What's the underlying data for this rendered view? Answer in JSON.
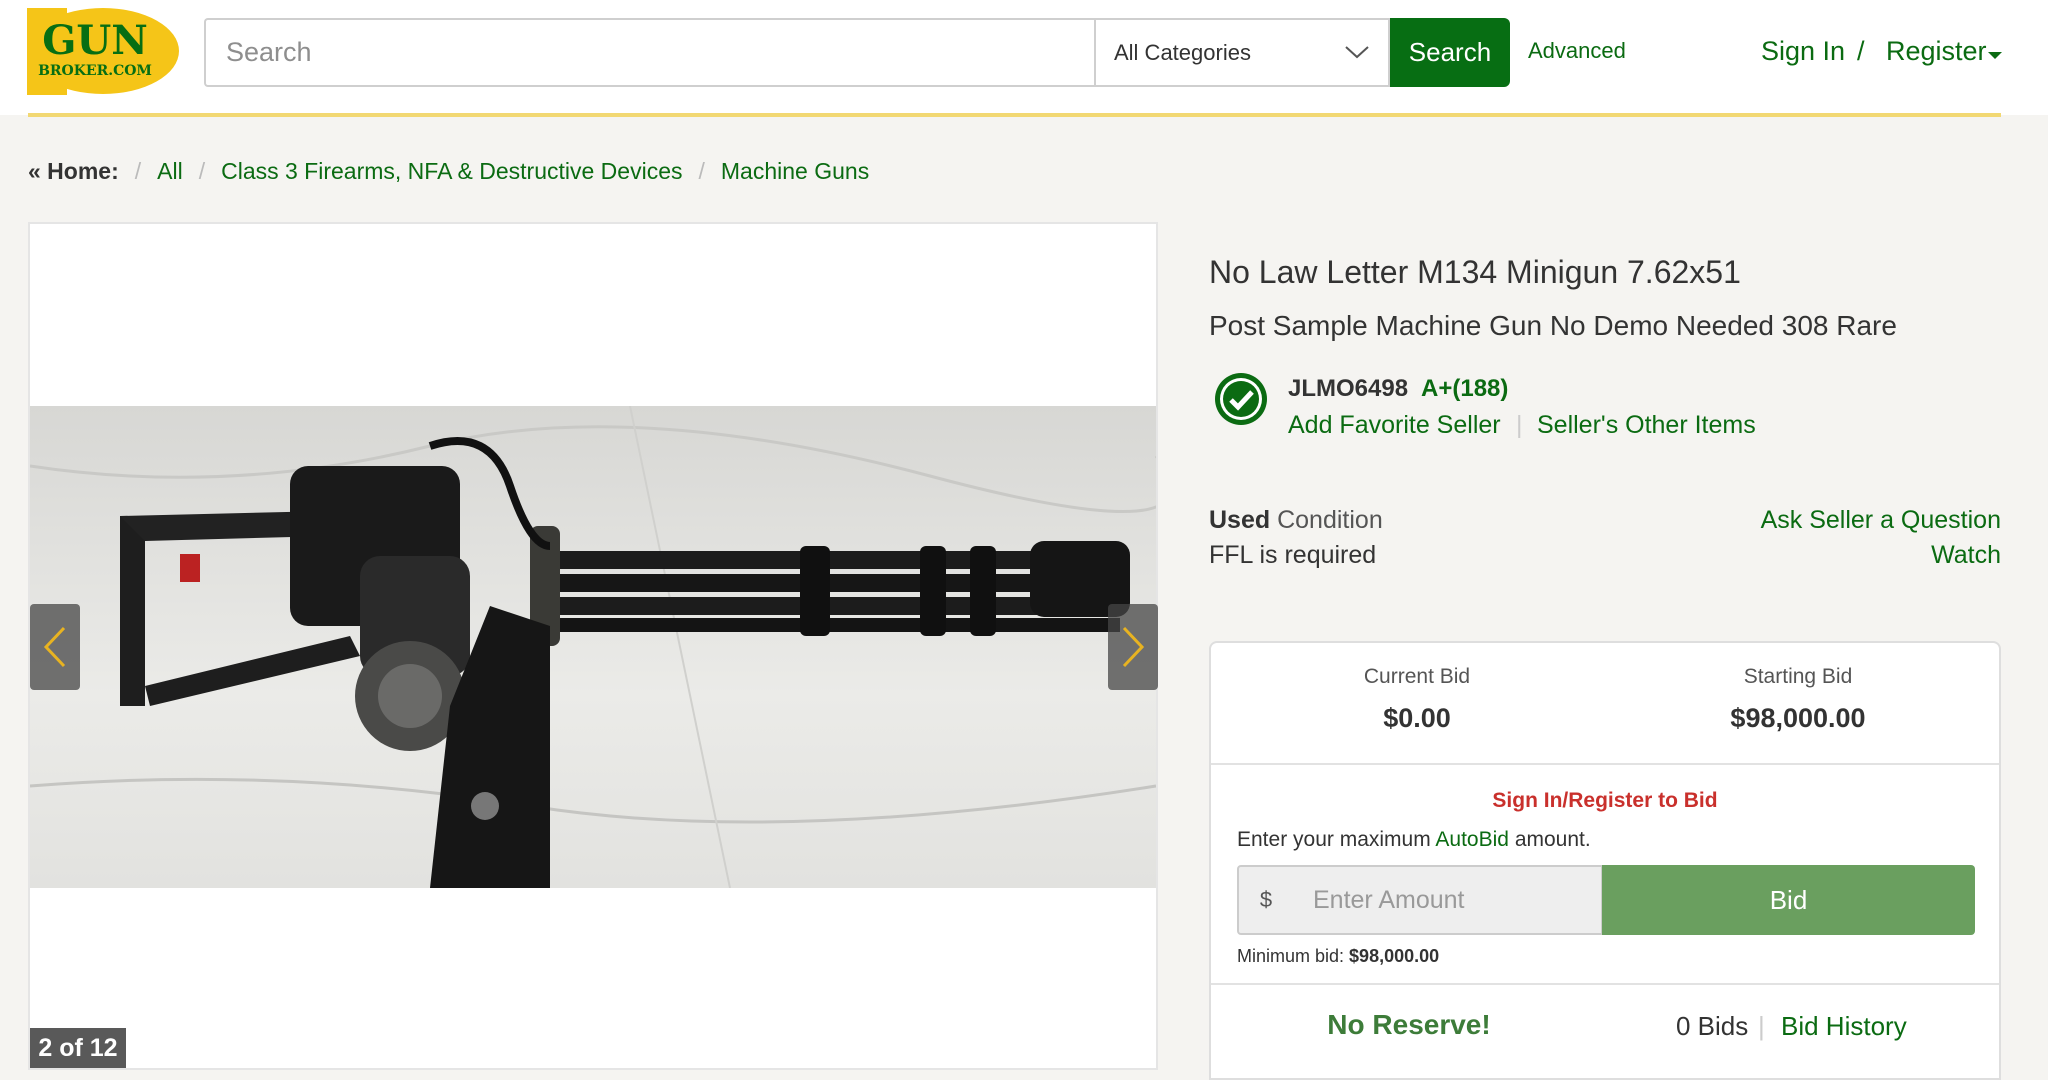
{
  "header": {
    "logo_top": "GUN",
    "logo_bottom": "BROKER.COM",
    "search_placeholder": "Search",
    "category_selected": "All Categories",
    "search_button": "Search",
    "advanced_link": "Advanced",
    "signin_link": "Sign In",
    "separator": "/",
    "register_link": "Register",
    "brand_green": "#076e13",
    "logo_yellow": "#f5c518"
  },
  "breadcrumb": {
    "home": "« Home:",
    "items": [
      "All",
      "Class 3 Firearms, NFA & Destructive Devices",
      "Machine Guns"
    ],
    "sep": "/"
  },
  "gallery": {
    "counter": "2 of 12",
    "prev_icon": "chevron-left-icon",
    "next_icon": "chevron-right-icon"
  },
  "listing": {
    "title": "No Law Letter M134 Minigun 7.62x51",
    "subtitle": "Post Sample Machine Gun No Demo Needed 308 Rare",
    "seller": {
      "name": "JLMO6498",
      "rating": "A+(188)",
      "add_favorite": "Add Favorite Seller",
      "other_items": "Seller's Other Items",
      "badge_icon": "verified-check-icon"
    },
    "condition_value": "Used",
    "condition_label": "Condition",
    "ffl": "FFL is required",
    "ask_question": "Ask Seller a Question",
    "watch": "Watch"
  },
  "bid": {
    "current_label": "Current Bid",
    "current_value": "$0.00",
    "starting_label": "Starting Bid",
    "starting_value": "$98,000.00",
    "signin_to_bid": "Sign In/Register to Bid",
    "enter_prefix": "Enter your maximum",
    "autobid": "AutoBid",
    "enter_suffix": "amount.",
    "currency": "$",
    "amount_placeholder": "Enter Amount",
    "bid_button": "Bid",
    "min_label": "Minimum bid:",
    "min_value": "$98,000.00",
    "no_reserve": "No Reserve!",
    "bids_count": "0 Bids",
    "bid_history": "Bid History"
  }
}
